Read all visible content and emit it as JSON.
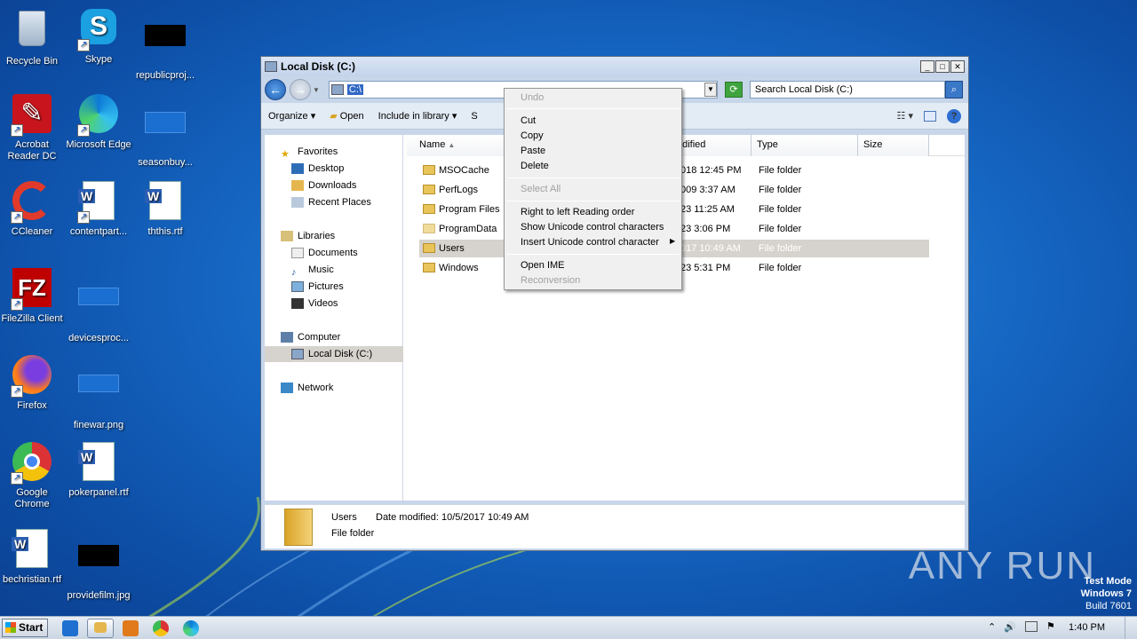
{
  "desktop": {
    "icons": [
      {
        "label": "Recycle Bin"
      },
      {
        "label": "Skype"
      },
      {
        "label": "republicproj..."
      },
      {
        "label": "Acrobat Reader DC"
      },
      {
        "label": "Microsoft Edge"
      },
      {
        "label": "seasonbuy..."
      },
      {
        "label": "CCleaner"
      },
      {
        "label": "contentpart..."
      },
      {
        "label": "ththis.rtf"
      },
      {
        "label": "FileZilla Client"
      },
      {
        "label": "devicesproc..."
      },
      {
        "label": "Firefox"
      },
      {
        "label": "finewar.png"
      },
      {
        "label": "Google Chrome"
      },
      {
        "label": "pokerpanel.rtf"
      },
      {
        "label": "bechristian.rtf"
      },
      {
        "label": "providefilm.jpg"
      }
    ]
  },
  "window": {
    "title": "Local Disk (C:)",
    "address": "C:\\",
    "search_placeholder": "Search Local Disk (C:)"
  },
  "toolbar": {
    "organize": "Organize",
    "open": "Open",
    "include": "Include in library",
    "share": "S"
  },
  "nav": {
    "favorites": "Favorites",
    "desktop": "Desktop",
    "downloads": "Downloads",
    "recent": "Recent Places",
    "libraries": "Libraries",
    "documents": "Documents",
    "music": "Music",
    "pictures": "Pictures",
    "videos": "Videos",
    "computer": "Computer",
    "localdisk": "Local Disk (C:)",
    "network": "Network"
  },
  "columns": {
    "name": "Name",
    "modified": "odified",
    "type": "Type",
    "size": "Size"
  },
  "files": [
    {
      "name": "MSOCache",
      "date": "018 12:45 PM",
      "type": "File folder"
    },
    {
      "name": "PerfLogs",
      "date": "009 3:37 AM",
      "type": "File folder"
    },
    {
      "name": "Program Files",
      "date": "23 11:25 AM",
      "type": "File folder"
    },
    {
      "name": "ProgramData",
      "date": "23 3:06 PM",
      "type": "File folder"
    },
    {
      "name": "Users",
      "date": "017 10:49 AM",
      "type": "File folder"
    },
    {
      "name": "Windows",
      "date": "23 5:31 PM",
      "type": "File folder"
    }
  ],
  "details": {
    "name": "Users",
    "modified": "Date modified: 10/5/2017 10:49 AM",
    "type": "File folder"
  },
  "menu": {
    "undo": "Undo",
    "cut": "Cut",
    "copy": "Copy",
    "paste": "Paste",
    "delete": "Delete",
    "selectall": "Select All",
    "rtl": "Right to left Reading order",
    "showuni": "Show Unicode control characters",
    "insertuni": "Insert Unicode control character",
    "openime": "Open IME",
    "reconv": "Reconversion"
  },
  "taskbar": {
    "start": "Start",
    "clock": "1:40 PM"
  },
  "watermark": "ANY RUN",
  "testmode": {
    "l1": "Test Mode",
    "l2": "Windows 7",
    "l3": "Build 7601"
  }
}
